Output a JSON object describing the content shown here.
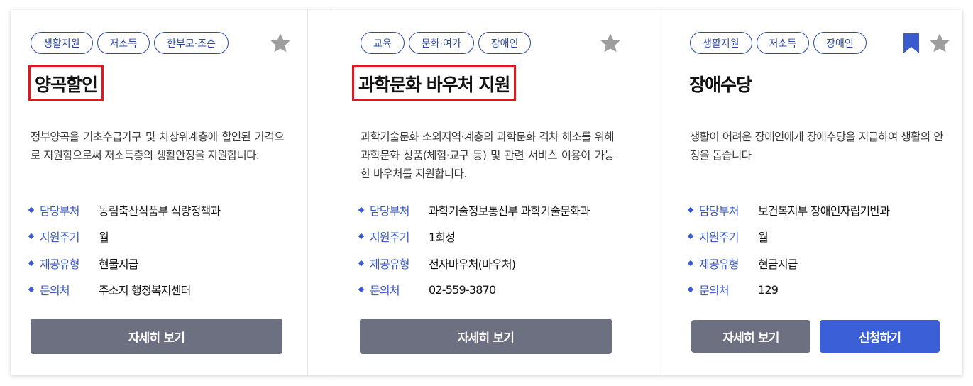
{
  "cards": [
    {
      "tags": [
        "생활지원",
        "저소득",
        "한부모·조손"
      ],
      "title": "양곡할인",
      "description": "정부양곡을 기초수급가구 및 차상위계층에 할인된 가격으로 지원함으로써 저소득층의 생활안정을 지원합니다.",
      "info": [
        {
          "key": "담당부처",
          "value": "농림축산식품부 식량정책과"
        },
        {
          "key": "지원주기",
          "value": "월"
        },
        {
          "key": "제공유형",
          "value": "현물지급"
        },
        {
          "key": "문의처",
          "value": "주소지 행정복지센터"
        }
      ],
      "detail_button": "자세히 보기",
      "bookmarked": false
    },
    {
      "tags": [
        "교육",
        "문화·여가",
        "장애인"
      ],
      "title": "과학문화 바우처 지원",
      "description": "과학기술문화 소외지역·계층의 과학문화 격차 해소를 위해 과학문화 상품(체험·교구 등) 및 관련 서비스 이용이 가능한 바우처를 지원합니다.",
      "info": [
        {
          "key": "담당부처",
          "value": "과학기술정보통신부 과학기술문화과"
        },
        {
          "key": "지원주기",
          "value": "1회성"
        },
        {
          "key": "제공유형",
          "value": "전자바우처(바우처)"
        },
        {
          "key": "문의처",
          "value": "02-559-3870"
        }
      ],
      "detail_button": "자세히 보기",
      "bookmarked": false
    },
    {
      "tags": [
        "생활지원",
        "저소득",
        "장애인"
      ],
      "title": "장애수당",
      "description": "생활이 어려운 장애인에게 장애수당을 지급하여 생활의 안정을 돕습니다",
      "info": [
        {
          "key": "담당부처",
          "value": "보건복지부 장애인자립기반과"
        },
        {
          "key": "지원주기",
          "value": "월"
        },
        {
          "key": "제공유형",
          "value": "현금지급"
        },
        {
          "key": "문의처",
          "value": "129"
        }
      ],
      "detail_button": "자세히 보기",
      "apply_button": "신청하기",
      "bookmarked": true
    }
  ],
  "colors": {
    "accent": "#3a5bcd",
    "tag_border": "#2c4aa8",
    "detail_button": "#6d7081",
    "apply_button": "#3b5fd6",
    "highlight_box": "#e8141c",
    "star": "#9e9e9e"
  },
  "icons": {
    "favorite": "star-icon",
    "bookmark": "bookmark-icon",
    "bullet": "diamond-bullet-icon"
  }
}
